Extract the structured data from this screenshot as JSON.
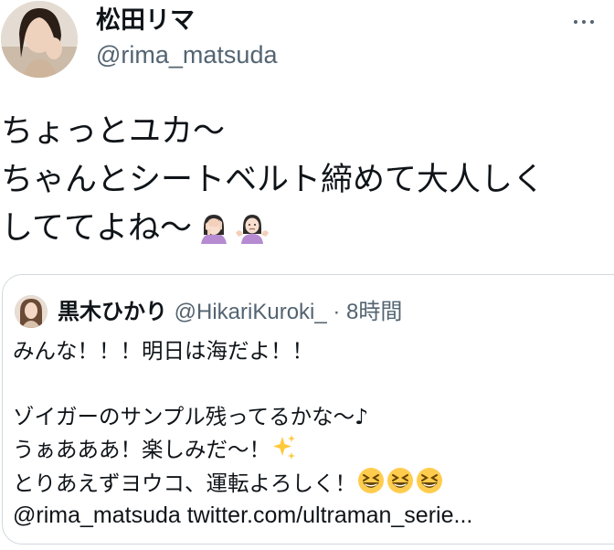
{
  "author": {
    "name": "松田リマ",
    "handle": "@rima_matsuda"
  },
  "header": {
    "more_icon": "more-horizontal-icon"
  },
  "tweet": {
    "lines": [
      "ちょっとユカ〜",
      "ちゃんとシートベルト締めて大人しく",
      "しててよね〜"
    ],
    "emojis": [
      "person-facepalming-emoji",
      "person-shrugging-emoji"
    ]
  },
  "quoted_tweet": {
    "name": "黒木ひかり",
    "handle": "@HikariKuroki_",
    "separator": " · ",
    "time": "8時間",
    "lines": [
      "みんな！！！明日は海だよ！！",
      "",
      "ゾイガーのサンプル残ってるかな〜♪",
      "うぁあああ！楽しみだ〜！",
      "とりあえずヨウコ、運転よろしく！",
      "@rima_matsuda twitter.com/ultraman_serie..."
    ],
    "emojis": {
      "line4": "sparkles-emoji",
      "line5": [
        "grinning-squinting-face-emoji",
        "grinning-squinting-face-emoji",
        "grinning-squinting-face-emoji"
      ]
    }
  },
  "colors": {
    "text": "#0f1419",
    "secondary": "#536471",
    "border": "#cfd9de"
  }
}
